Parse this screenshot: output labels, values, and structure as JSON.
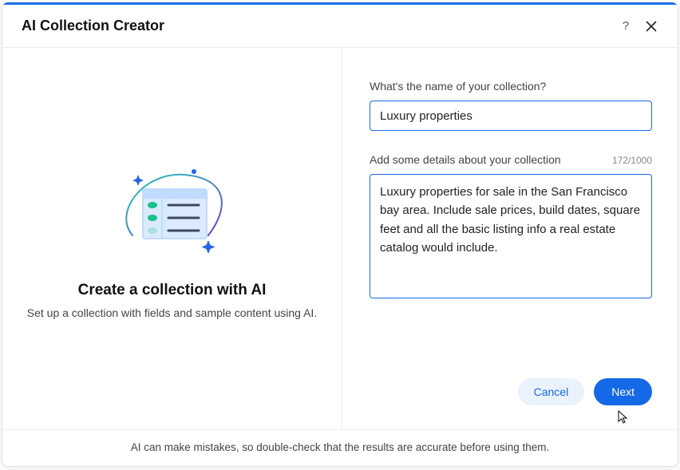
{
  "header": {
    "title": "AI Collection Creator"
  },
  "left": {
    "title": "Create a collection with AI",
    "subtitle": "Set up a collection with fields and sample content using AI."
  },
  "form": {
    "name_label": "What's the name of your collection?",
    "name_value": "Luxury properties",
    "details_label": "Add some details about your collection",
    "details_value": "Luxury properties for sale in the San Francisco bay area. Include sale prices, build dates, square feet and all the basic listing info a real estate catalog would include.",
    "char_count": "172/1000"
  },
  "actions": {
    "cancel": "Cancel",
    "next": "Next"
  },
  "footer": {
    "text": "AI can make mistakes, so double-check that the results are accurate before using them."
  }
}
